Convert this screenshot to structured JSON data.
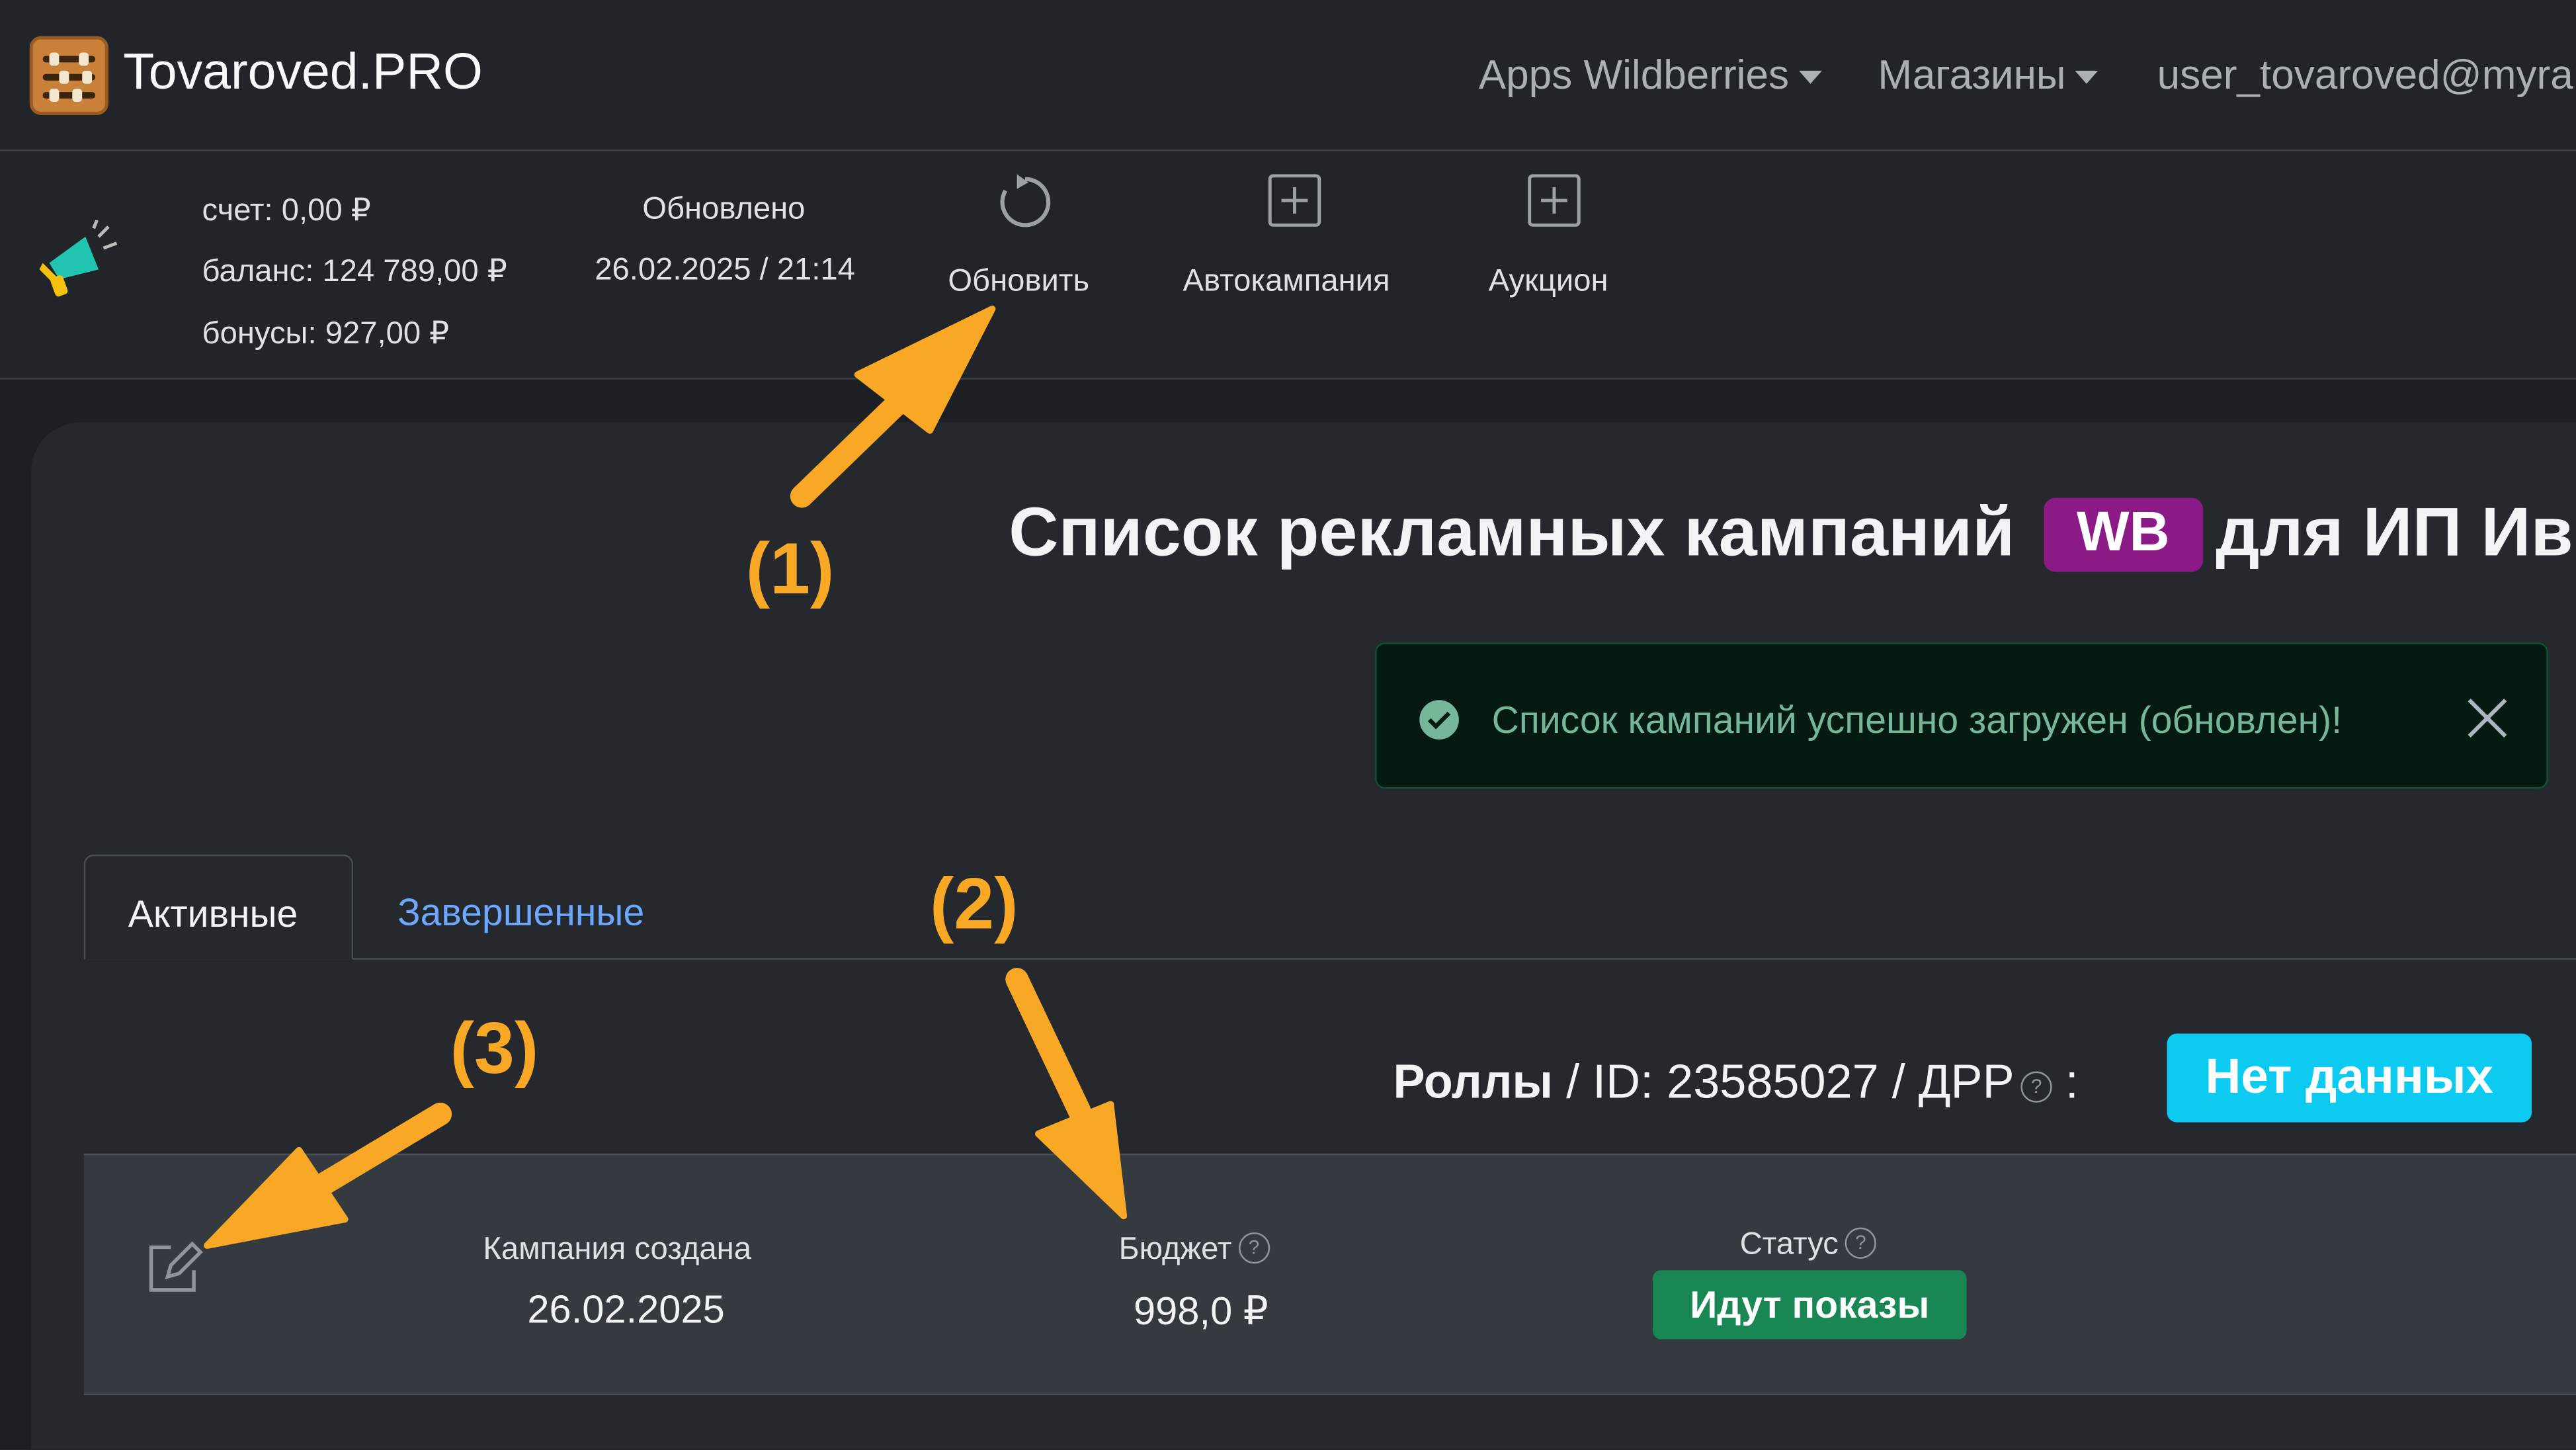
{
  "navbar": {
    "brand": "Tovaroved.PRO",
    "apps_menu": "Apps Wildberries",
    "shops_menu": "Магазины",
    "user_menu": "user_tovaroved@myran"
  },
  "account": {
    "account": "счет: 0,00 ₽",
    "balance": "баланс: 124 789,00 ₽",
    "bonuses": "бонусы: 927,00 ₽"
  },
  "updated": {
    "label": "Обновлено",
    "datetime": "26.02.2025 / 21:14"
  },
  "actions": {
    "refresh": "Обновить",
    "auto_campaign": "Автокампания",
    "auction": "Аукцион"
  },
  "page": {
    "title_before": "Список рекламных кампаний",
    "badge": "WB",
    "title_after": "для ИП Ив"
  },
  "alert": {
    "message": "Список кампаний успешно загружен (обновлен)!"
  },
  "tabs": {
    "active": "Активные",
    "finished": "Завершенные"
  },
  "campaign": {
    "name": "Роллы",
    "id_text": " / ID: 23585027 / ДРР",
    "colon": " :",
    "drr_value": "Нет данных",
    "created_label": "Кампания создана",
    "created_value": "26.02.2025",
    "budget_label": "Бюджет",
    "budget_value": "998,0 ₽",
    "status_label": "Статус",
    "status_value": "Идут показы"
  },
  "annotations": {
    "a1": "(1)",
    "a2": "(2)",
    "a3": "(3)"
  },
  "colors": {
    "annotation": "#f9a825",
    "wb_badge": "#8b1a86",
    "info_button": "#0dcaf0",
    "success_badge": "#198754",
    "tab_link": "#6ea8fe"
  },
  "icons": {
    "logo": "abacus-icon",
    "advertising": "megaphone-icon",
    "refresh": "refresh-icon",
    "add": "plus-square-icon",
    "success": "check-circle-icon",
    "close": "close-icon",
    "edit": "edit-icon",
    "help": "question-circle-icon"
  }
}
